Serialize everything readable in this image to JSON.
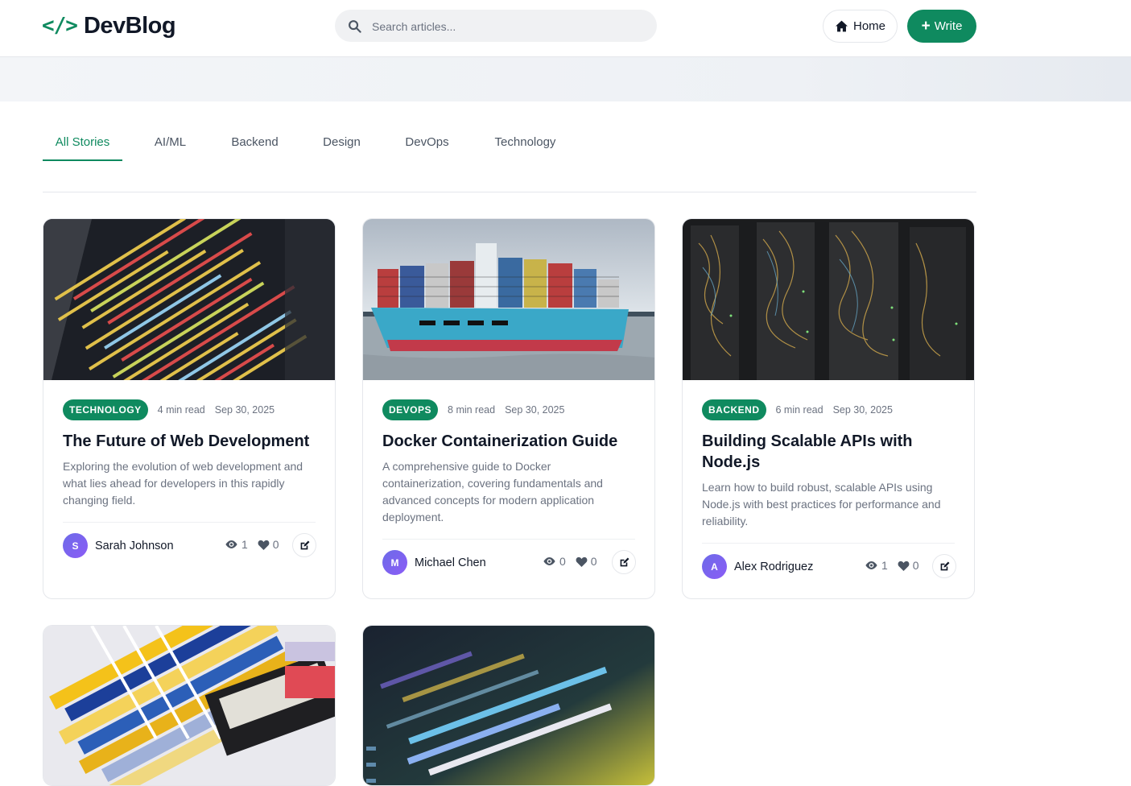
{
  "header": {
    "logo_icon": "</>",
    "logo_text": "DevBlog",
    "search_placeholder": "Search articles...",
    "home_label": "Home",
    "write_label": "Write",
    "accent": "#0f8a5f"
  },
  "tabs": [
    {
      "label": "All Stories",
      "active": true
    },
    {
      "label": "AI/ML",
      "active": false
    },
    {
      "label": "Backend",
      "active": false
    },
    {
      "label": "Design",
      "active": false
    },
    {
      "label": "DevOps",
      "active": false
    },
    {
      "label": "Technology",
      "active": false
    }
  ],
  "posts": [
    {
      "category": "TECHNOLOGY",
      "read_time": "4 min read",
      "date": "Sep 30, 2025",
      "title": "The Future of Web Development",
      "excerpt": "Exploring the evolution of web development and what lies ahead for developers in this rapidly changing field.",
      "author_initial": "S",
      "author": "Sarah Johnson",
      "views": "1",
      "likes": "0",
      "image": "code-on-screen"
    },
    {
      "category": "DEVOPS",
      "read_time": "8 min read",
      "date": "Sep 30, 2025",
      "title": "Docker Containerization Guide",
      "excerpt": "A comprehensive guide to Docker containerization, covering fundamentals and advanced concepts for modern application deployment.",
      "author_initial": "M",
      "author": "Michael Chen",
      "views": "0",
      "likes": "0",
      "image": "container-ship"
    },
    {
      "category": "BACKEND",
      "read_time": "6 min read",
      "date": "Sep 30, 2025",
      "title": "Building Scalable APIs with Node.js",
      "excerpt": "Learn how to build robust, scalable APIs using Node.js with best practices for performance and reliability.",
      "author_initial": "A",
      "author": "Alex Rodriguez",
      "views": "1",
      "likes": "0",
      "image": "server-racks"
    },
    {
      "image": "color-swatches"
    },
    {
      "image": "php-code"
    }
  ]
}
